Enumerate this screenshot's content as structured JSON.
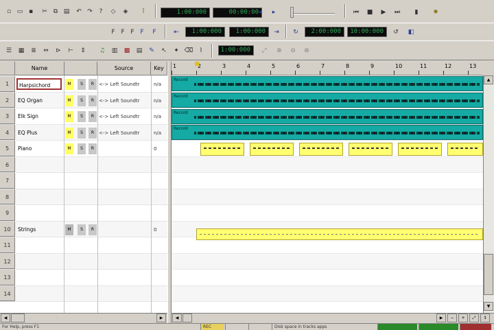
{
  "colors": {
    "audio_clip": "#16aaa4",
    "midi_clip": "#ffff70",
    "lcd_text": "#2ea95a",
    "selected_track_border": "#a03030"
  },
  "toolbar1": {
    "icons": [
      "new-icon",
      "open-icon",
      "save-icon",
      "cut-icon",
      "copy-icon",
      "paste-icon",
      "undo-icon",
      "redo-icon",
      "help-icon",
      "metronome-icon",
      "record-arm-icon"
    ],
    "time_display_1": "1:00:000",
    "time_display_2": "00:00:00",
    "transport": [
      "rewind-icon",
      "stop-icon",
      "play-icon",
      "fast-forward-icon",
      "record-icon",
      "settings-icon"
    ]
  },
  "toolbar2": {
    "from_display": "1:00:000",
    "thru_display": "1:00:000",
    "loop_start": "2:00:000",
    "loop_end": "10:00:000"
  },
  "toolbar3": {
    "zoom_display": "1:00:000"
  },
  "track_headers": {
    "name": "Name",
    "source": "Source",
    "key": "Key"
  },
  "tracks": [
    {
      "num": "1",
      "name": "Harpsichord",
      "m1": "M",
      "m2": "S",
      "m3": "R",
      "source": "<-> Left Soundtr",
      "key": "n/a",
      "selected": true
    },
    {
      "num": "2",
      "name": "EQ Organ",
      "m1": "M",
      "m2": "S",
      "m3": "R",
      "source": "<-> Left Soundtr",
      "key": "n/a"
    },
    {
      "num": "3",
      "name": "Elk Sign",
      "m1": "M",
      "m2": "S",
      "m3": "R",
      "source": "<-> Left Soundtr",
      "key": "n/a"
    },
    {
      "num": "4",
      "name": "EQ Plus",
      "m1": "M",
      "m2": "S",
      "m3": "R",
      "source": "<-> Left Soundtr",
      "key": "n/a"
    },
    {
      "num": "5",
      "name": "Piano",
      "m1": "M",
      "m2": "S",
      "m3": "R",
      "source": "",
      "key": "0"
    },
    {
      "num": "6",
      "name": "",
      "source": "",
      "key": ""
    },
    {
      "num": "7",
      "name": "",
      "source": "",
      "key": ""
    },
    {
      "num": "8",
      "name": "",
      "source": "",
      "key": ""
    },
    {
      "num": "9",
      "name": "",
      "source": "",
      "key": ""
    },
    {
      "num": "10",
      "name": "Strings",
      "m1": "M",
      "m2": "S",
      "m3": "R",
      "source": "",
      "key": "0"
    },
    {
      "num": "11",
      "name": "",
      "source": "",
      "key": ""
    },
    {
      "num": "12",
      "name": "",
      "source": "",
      "key": ""
    },
    {
      "num": "13",
      "name": "",
      "source": "",
      "key": ""
    },
    {
      "num": "14",
      "name": "",
      "source": "",
      "key": ""
    }
  ],
  "ruler": [
    "1",
    "2",
    "3",
    "4",
    "5",
    "6",
    "7",
    "8",
    "9",
    "10",
    "11",
    "12",
    "13"
  ],
  "clips": {
    "audio_label": "Record"
  },
  "statusbar": {
    "help": "For Help, press F1",
    "mode": "REC",
    "info": "Disk space in tracks apps"
  }
}
